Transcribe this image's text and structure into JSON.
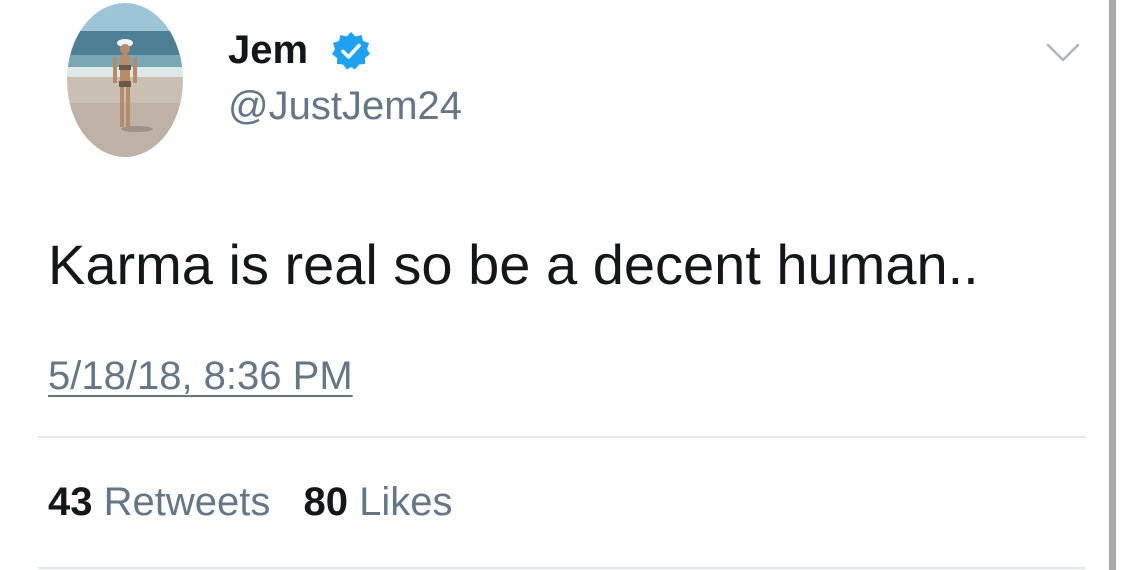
{
  "author": {
    "display_name": "Jem",
    "handle": "@JustJem24",
    "verified": true
  },
  "tweet": {
    "text": "Karma is real so be a decent human..",
    "timestamp": "5/18/18, 8:36 PM"
  },
  "stats": {
    "retweets_count": "43",
    "retweets_label": "Retweets",
    "likes_count": "80",
    "likes_label": "Likes"
  },
  "colors": {
    "text_primary": "#14171a",
    "text_secondary": "#657786",
    "verified_blue": "#1da1f2",
    "divider": "#e1e8ed"
  },
  "icons": {
    "verified": "verified-badge-icon",
    "menu": "chevron-down-icon"
  }
}
